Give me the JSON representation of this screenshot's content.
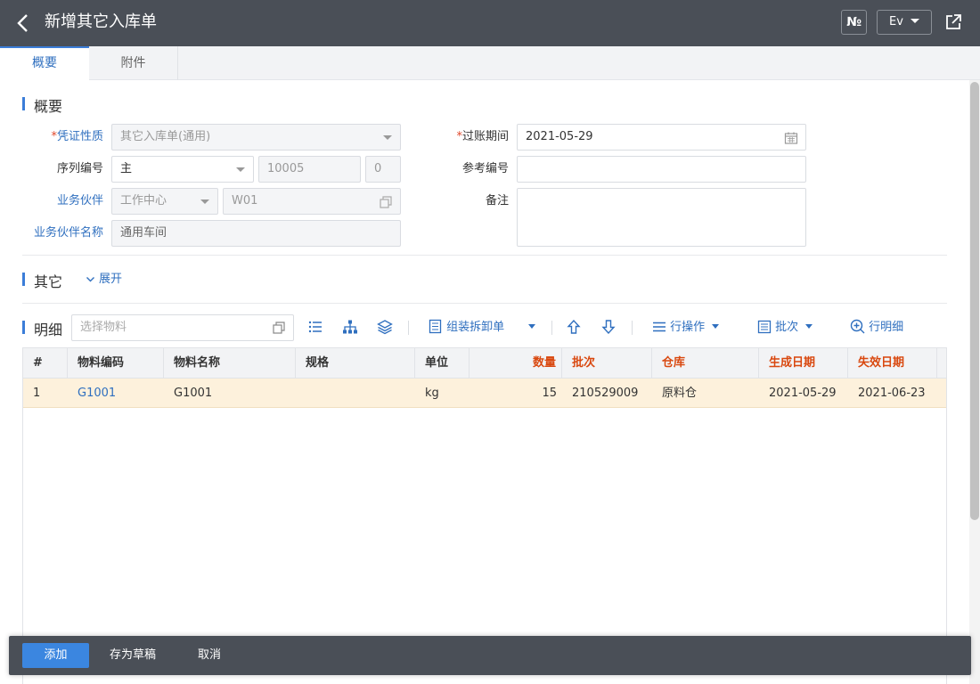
{
  "header": {
    "title": "新增其它入库单",
    "no_label": "№",
    "lang_label": "Ev"
  },
  "tabs": [
    {
      "label": "概要"
    },
    {
      "label": "附件"
    }
  ],
  "summary": {
    "section_title": "概要",
    "voucher_type": {
      "label": "凭证性质",
      "value": "其它入库单(通用)"
    },
    "serial": {
      "label": "序列编号",
      "prefix": "主",
      "number": "10005",
      "suffix": "0"
    },
    "partner": {
      "label": "业务伙伴",
      "type": "工作中心",
      "code": "W01"
    },
    "partner_name": {
      "label": "业务伙伴名称",
      "value": "通用车间"
    },
    "posting_period": {
      "label": "过账期间",
      "value": "2021-05-29"
    },
    "reference": {
      "label": "参考编号",
      "value": ""
    },
    "remark": {
      "label": "备注",
      "value": ""
    }
  },
  "other": {
    "section_title": "其它",
    "expand_label": "展开"
  },
  "detail": {
    "section_title": "明细",
    "search_placeholder": "选择物料",
    "tools": {
      "assemble": "组装拆卸单",
      "row_ops": "行操作",
      "batch": "批次",
      "row_detail": "行明细"
    },
    "columns": [
      "#",
      "物料编码",
      "物料名称",
      "规格",
      "单位",
      "数量",
      "批次",
      "仓库",
      "生成日期",
      "失效日期"
    ],
    "rows": [
      {
        "no": "1",
        "code": "G1001",
        "name": "G1001",
        "spec": "",
        "unit": "kg",
        "qty": "15",
        "batch": "210529009",
        "warehouse": "原料仓",
        "made": "2021-05-29",
        "expire": "2021-06-23"
      }
    ]
  },
  "footer": {
    "add": "添加",
    "save_draft": "存为草稿",
    "cancel": "取消"
  },
  "colors": {
    "topbar": "#4a4f57",
    "accent": "#3b7dd8",
    "required": "#e0482b",
    "row_highlight": "#fdf1dc"
  }
}
